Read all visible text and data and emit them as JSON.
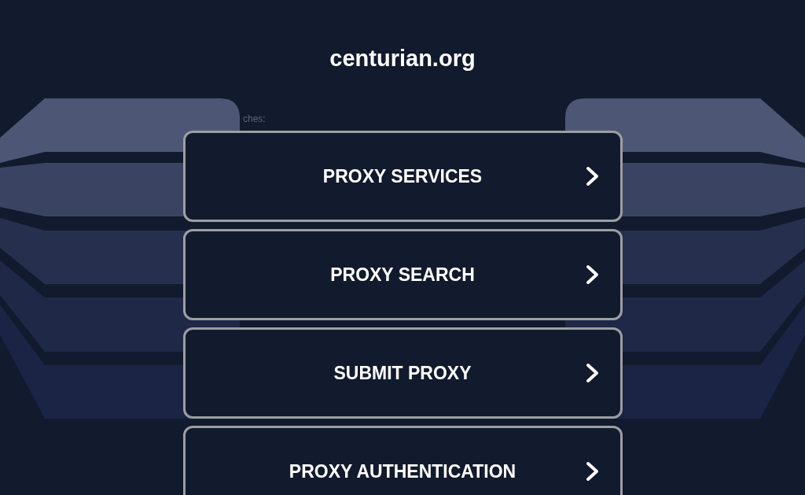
{
  "site_title": "centurian.org",
  "related_label": "ches:",
  "links": [
    {
      "label": "PROXY SERVICES"
    },
    {
      "label": "PROXY SEARCH"
    },
    {
      "label": "SUBMIT PROXY"
    },
    {
      "label": "PROXY AUTHENTICATION"
    }
  ]
}
